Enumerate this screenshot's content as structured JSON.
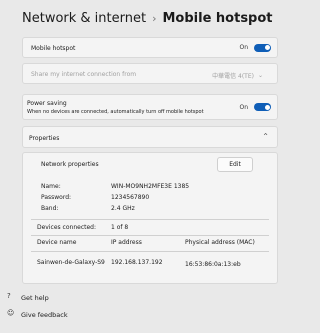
{
  "breadcrumb": {
    "parent": "Network & internet",
    "separator": "›",
    "current": "Mobile hotspot"
  },
  "mobile_hotspot": {
    "label": "Mobile hotspot",
    "state": "On"
  },
  "share_from": {
    "label": "Share my internet connection from",
    "value": "中華電信 4(TE)"
  },
  "power_saving": {
    "label": "Power saving",
    "description": "When no devices are connected, automatically turn off mobile hotspot",
    "state": "On"
  },
  "properties": {
    "header": "Properties",
    "network_properties_label": "Network properties",
    "edit_label": "Edit",
    "name_label": "Name:",
    "name_value": "WIN-MO9NH2MFE3E 1385",
    "password_label": "Password:",
    "password_value": "1234567890",
    "band_label": "Band:",
    "band_value": "2.4 GHz",
    "devices_connected_label": "Devices connected:",
    "devices_connected_value": "1 of 8",
    "table_headers": [
      "Device name",
      "IP address",
      "Physical address (MAC)"
    ],
    "table_rows": [
      {
        "device": "Sainwen-de-Galaxy-S9",
        "ip": "192.168.137.192",
        "mac": "16:53:86:0a:13:eb"
      }
    ]
  },
  "footer": {
    "help_label": "Get help",
    "feedback_label": "Give feedback"
  }
}
